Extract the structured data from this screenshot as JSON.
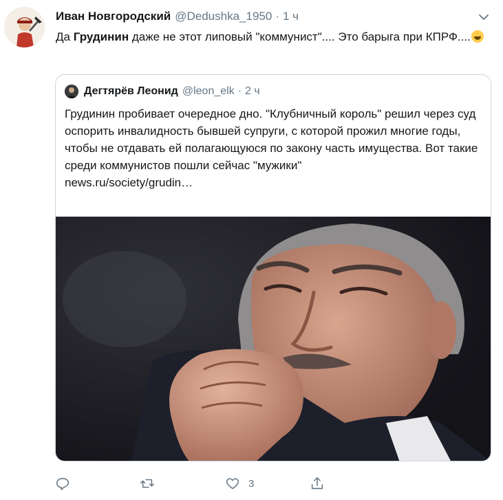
{
  "tweet": {
    "author_name": "Иван Новгородский",
    "author_handle": "@Dedushka_1950",
    "separator": "·",
    "time": "1 ч",
    "text_before": "Да ",
    "text_bold": "Грудинин",
    "text_after": " даже не этот липовый   \"коммунист\".... Это  барыга при КПРФ....",
    "emoji_name": "rolling-on-floor-laughing-emoji"
  },
  "quoted_tweet": {
    "author_name": "Дегтярёв Леонид",
    "author_handle": "@leon_elk",
    "separator": "·",
    "time": "2 ч",
    "text": "Грудинин пробивает очередное дно. \"Клубничный король\" решил через суд оспорить инвалидность бывшей супруги, с которой прожил многие годы, чтобы не отдавать ей полагающуюся по закону часть имущества. Вот такие среди коммунистов пошли сейчас \"мужики\"",
    "link": "news.ru/society/grudin…",
    "image_name": "photo-man-hand-on-chin"
  },
  "actions": {
    "reply_icon": "reply-icon",
    "retweet_icon": "retweet-icon",
    "like_icon": "heart-icon",
    "like_count": "3",
    "share_icon": "share-icon"
  },
  "colors": {
    "text_primary": "#14171a",
    "text_secondary": "#657786",
    "border": "#ccd6dd"
  }
}
